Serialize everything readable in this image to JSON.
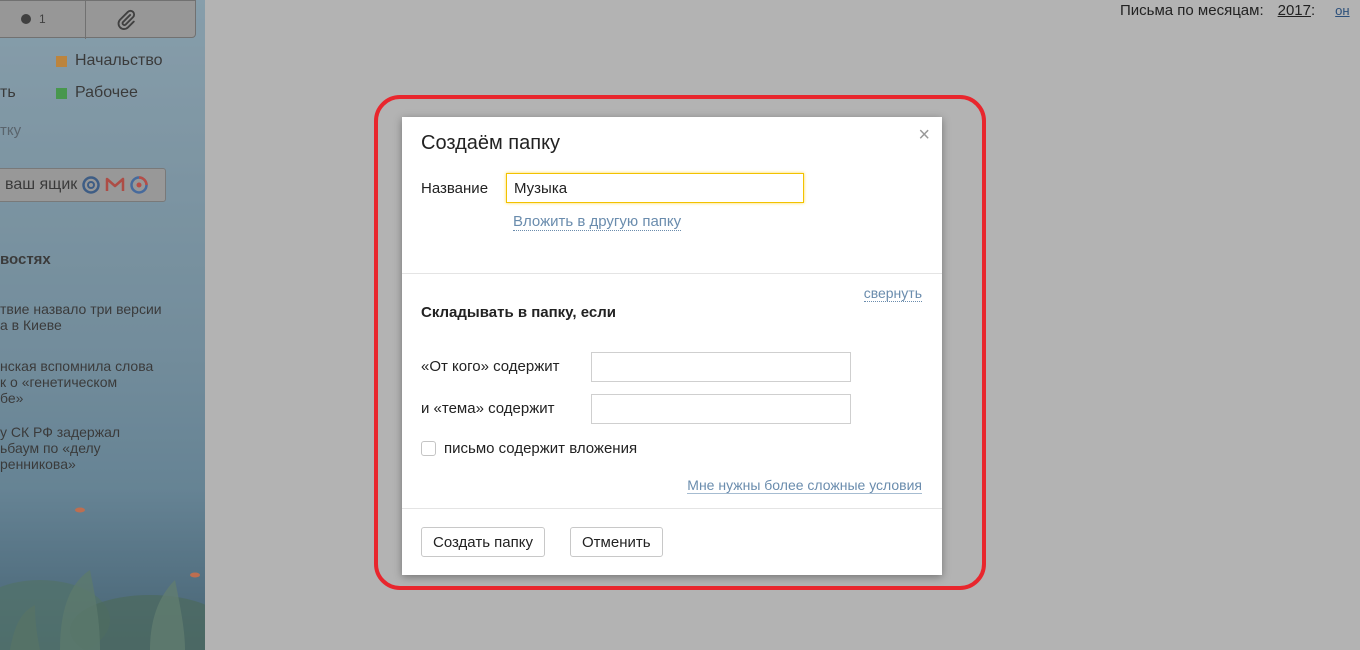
{
  "sidebar": {
    "toolbar": {
      "unread_count": "1",
      "unread_icon": "dot-icon",
      "attach_icon": "paperclip-icon"
    },
    "labels": [
      {
        "name": "Начальство",
        "color": "#e08a1e"
      },
      {
        "name": "Рабочее",
        "color": "#2ea836"
      }
    ],
    "cut_text_1": "ть",
    "cut_text_2": "тку",
    "mailbox_button": "ваш ящик",
    "mailbox_icons": [
      "mailru-icon",
      "gmail-icon",
      "rambler-icon"
    ],
    "news_heading": "востях",
    "news": [
      {
        "line1": "твие назвало три версии",
        "line2": "а в Киеве"
      },
      {
        "line1": "нская вспомнила слова",
        "line2": "к о «генетическом",
        "line3": "бе»"
      },
      {
        "line1": "у СК РФ задержал",
        "line2": "ьбаум по «делу",
        "line3": "ренникова»"
      }
    ]
  },
  "header": {
    "month_stats_label": "Письма по месяцам:",
    "year": "2017",
    "year_suffix": ":",
    "more": "он"
  },
  "dialog": {
    "title": "Создаём папку",
    "close_label": "×",
    "name_label": "Название",
    "name_value": "Музыка",
    "nest_link": "Вложить в другую папку",
    "collapse_link": "свернуть",
    "rules_heading": "Складывать в папку, если",
    "from_label": "«От кого» содержит",
    "from_value": "",
    "subject_label": "и «тема» содержит",
    "subject_value": "",
    "attachment_label": "письмо содержит вложения",
    "complex_link": "Мне нужны более сложные условия",
    "create_button": "Создать папку",
    "cancel_button": "Отменить"
  },
  "colors": {
    "highlight": "#e8262d",
    "link": "#6a8cad",
    "input_focus": "#f2c200"
  }
}
